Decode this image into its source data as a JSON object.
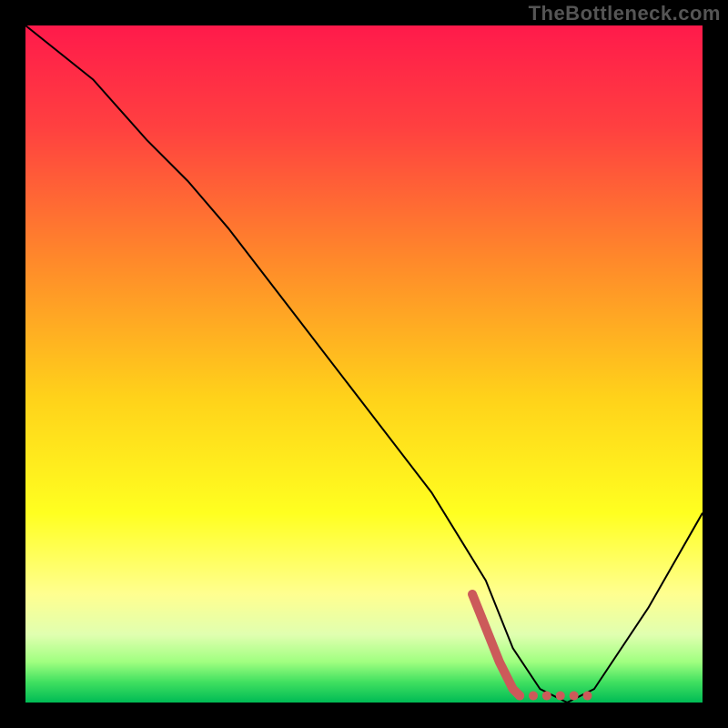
{
  "watermark": "TheBottleneck.com",
  "chart_data": {
    "type": "line",
    "title": "",
    "xlabel": "",
    "ylabel": "",
    "xlim": [
      0,
      100
    ],
    "ylim": [
      0,
      100
    ],
    "grid": false,
    "legend": false,
    "background_gradient": {
      "stops": [
        {
          "offset": 0.0,
          "color": "#ff1a4b"
        },
        {
          "offset": 0.15,
          "color": "#ff4040"
        },
        {
          "offset": 0.35,
          "color": "#ff8a2a"
        },
        {
          "offset": 0.55,
          "color": "#ffd21a"
        },
        {
          "offset": 0.72,
          "color": "#ffff20"
        },
        {
          "offset": 0.84,
          "color": "#ffff90"
        },
        {
          "offset": 0.9,
          "color": "#e0ffb0"
        },
        {
          "offset": 0.94,
          "color": "#a0ff80"
        },
        {
          "offset": 0.97,
          "color": "#40e060"
        },
        {
          "offset": 1.0,
          "color": "#00bb55"
        }
      ]
    },
    "series": [
      {
        "name": "bottleneck-curve",
        "type": "line",
        "color": "#000000",
        "x": [
          0,
          10,
          18,
          24,
          30,
          40,
          50,
          60,
          68,
          72,
          76,
          80,
          84,
          92,
          100
        ],
        "y": [
          100,
          92,
          83,
          77,
          70,
          57,
          44,
          31,
          18,
          8,
          2,
          0,
          2,
          14,
          28
        ]
      },
      {
        "name": "optimal-region-marker",
        "type": "line",
        "color": "#cc5a5a",
        "stroke_width": 10,
        "x": [
          66,
          68,
          70,
          72,
          73,
          75,
          77,
          79,
          81,
          83
        ],
        "y": [
          16,
          11,
          6,
          2,
          1,
          1,
          1,
          1,
          1,
          1
        ],
        "style_segments": [
          {
            "from": 0,
            "to": 4,
            "dash": "solid"
          },
          {
            "from": 4,
            "to": 9,
            "dash": "dotted"
          }
        ]
      }
    ]
  }
}
